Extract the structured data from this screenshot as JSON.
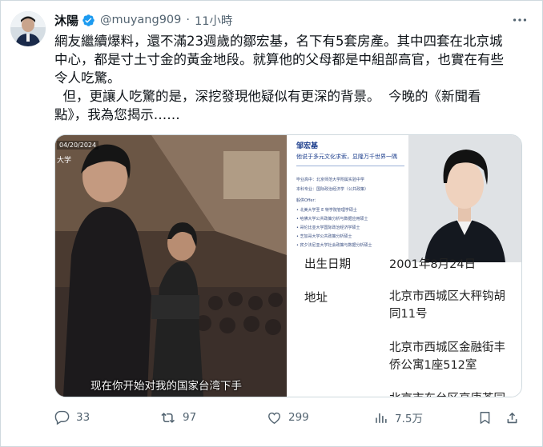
{
  "post": {
    "display_name": "沐陽",
    "handle": "@muyang909",
    "separator": "·",
    "time": "11小時",
    "text": "網友繼續爆料，還不滿23週歲的鄒宏基，名下有5套房產。其中四套在北京城\n中心，都是寸土寸金的黃金地段。就算他的父母都是中組部高官，也實在有些\n令人吃驚。\n  但，更讓人吃驚的是，深挖發現他疑似有更深的背景。  今晚的《新聞看\n點》，我為您揭示……"
  },
  "media": {
    "video": {
      "date_stamp": "04/20/2024",
      "tag": "大学",
      "subtitle": "现在你开始对我的国家台湾下手"
    },
    "document": {
      "name": "邹宏基",
      "slogan": "他说于多元文化求索，显隆万千世界一隅",
      "lines": [
        "毕业高中：北京师范大学附属实验中学",
        "本科专业：国际政治经济学（公共政策）",
        "毅供Offer：",
        "• 北美大学圣 E 特学院管理学硕士",
        "• 哈佛大学公共政策分析与数据应用硕士",
        "• 哥伦比亚大学国际政治经济学硕士",
        "• 芝加哥大学公共政策分析硕士",
        "• 宾夕法尼亚大学社会政策与数据分析硕士"
      ],
      "birth_clip": "出生日期",
      "birth_value_clip": "2001年8月24日",
      "address_label": "地址",
      "address_1": "北京市西城区大秤钩胡\n同11号",
      "address_2": "北京市西城区金融街丰\n侨公寓1座512室",
      "address_3_clip": "北京市东台区高唐苍园"
    }
  },
  "actions": {
    "replies": "33",
    "reposts": "97",
    "likes": "299",
    "views": "7.5万"
  },
  "colors": {
    "verified": "#1d9bf0",
    "muted": "#536471",
    "border": "#cfd9de",
    "doc_blue": "#1b3d8c"
  }
}
